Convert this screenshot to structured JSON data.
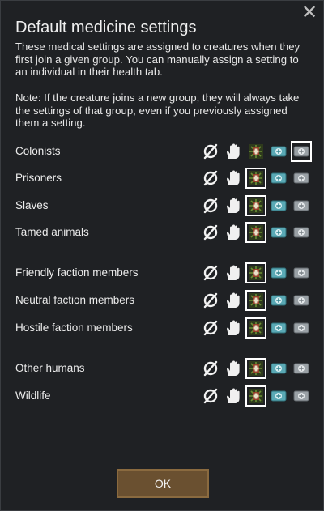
{
  "dialog": {
    "title": "Default medicine settings",
    "description": "These medical settings are assigned to creatures when they first join a given group. You can manually assign a setting to an individual in their health tab.",
    "note": "Note: If the creature joins a new group, they will always take the settings of that group, even if you previously assigned them a setting.",
    "ok_label": "OK"
  },
  "icons": [
    "no-care-icon",
    "doctor-care-hand-icon",
    "herbal-medicine-icon",
    "industrial-medicine-icon",
    "glitterworld-medicine-icon"
  ],
  "rows": [
    {
      "label": "Colonists",
      "selected": 4
    },
    {
      "label": "Prisoners",
      "selected": 2
    },
    {
      "label": "Slaves",
      "selected": 2
    },
    {
      "label": "Tamed animals",
      "selected": 2
    },
    {
      "label": "Friendly faction members",
      "selected": 2
    },
    {
      "label": "Neutral faction members",
      "selected": 2
    },
    {
      "label": "Hostile faction members",
      "selected": 2
    },
    {
      "label": "Other humans",
      "selected": 2
    },
    {
      "label": "Wildlife",
      "selected": 2
    }
  ]
}
